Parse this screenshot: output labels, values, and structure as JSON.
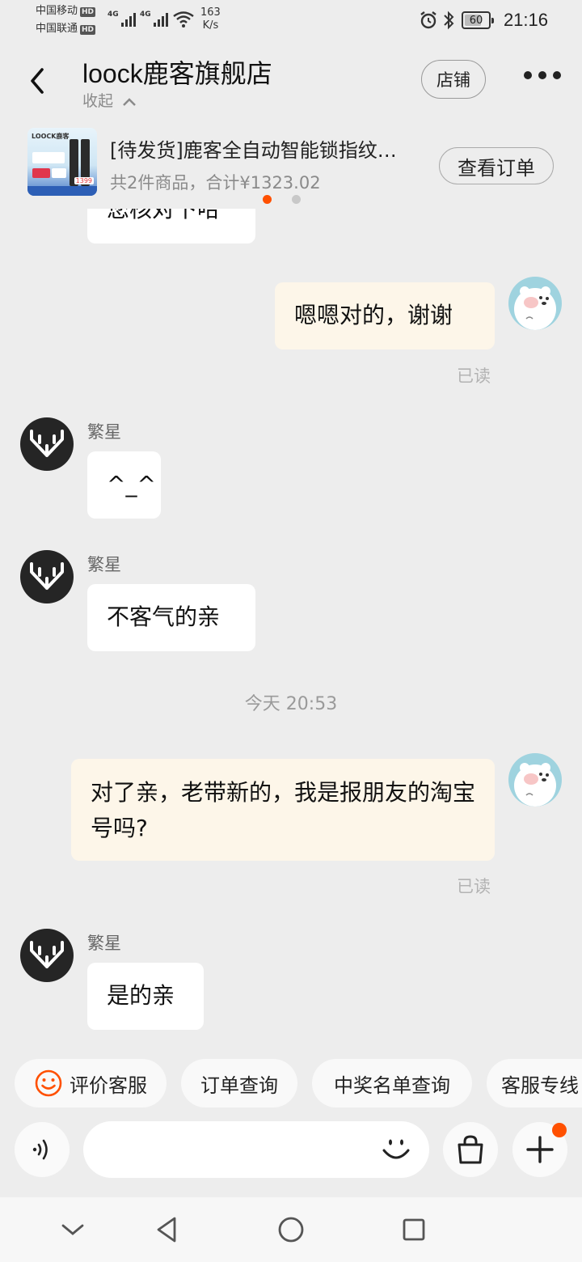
{
  "status_bar": {
    "carrier1": "中国移动",
    "carrier2": "中国联通",
    "hd": "HD",
    "net1": "4G",
    "net2": "4G",
    "speed_value": "163",
    "speed_unit": "K/s",
    "battery": "60",
    "time": "21:16"
  },
  "header": {
    "title": "loock鹿客旗舰店",
    "collapse_label": "收起",
    "store_button": "店铺",
    "more_icon": "more-horizontal-icon"
  },
  "order_card": {
    "title": "[待发货]鹿客全自动智能锁指纹…",
    "summary": "共2件商品，合计¥1323.02",
    "button": "查看订单",
    "thumb_logo": "LOOCK鹿客",
    "thumb_price": "1399",
    "page_count": 2,
    "active_page": 1
  },
  "messages": [
    {
      "id": "m0",
      "side": "left",
      "text": "您核对下哈",
      "partially_visible": true
    },
    {
      "id": "m1",
      "side": "right",
      "text": "嗯嗯对的，谢谢",
      "status": "已读"
    },
    {
      "id": "m2",
      "side": "left",
      "sender": "繁星",
      "text": "^_^"
    },
    {
      "id": "m3",
      "side": "left",
      "sender": "繁星",
      "text": "不客气的亲"
    },
    {
      "id": "m4",
      "side": "right",
      "text": "对了亲，老带新的，我是报朋友的淘宝号吗?",
      "status": "已读"
    },
    {
      "id": "m5",
      "side": "left",
      "sender": "繁星",
      "text": "是的亲"
    }
  ],
  "time_separator": "今天  20:53",
  "quick_replies": [
    {
      "label": "评价客服",
      "icon": "smile-icon"
    },
    {
      "label": "订单查询"
    },
    {
      "label": "中奖名单查询"
    },
    {
      "label": "客服专线"
    }
  ],
  "input_bar": {
    "placeholder": "",
    "voice_icon": "voice-icon",
    "emoji_icon": "emoji-icon",
    "bag_icon": "shopping-bag-icon",
    "plus_icon": "plus-icon"
  },
  "colors": {
    "background": "#ededed",
    "user_bubble": "#fdf6e9",
    "agent_bubble": "#ffffff",
    "accent": "#ff5000"
  }
}
